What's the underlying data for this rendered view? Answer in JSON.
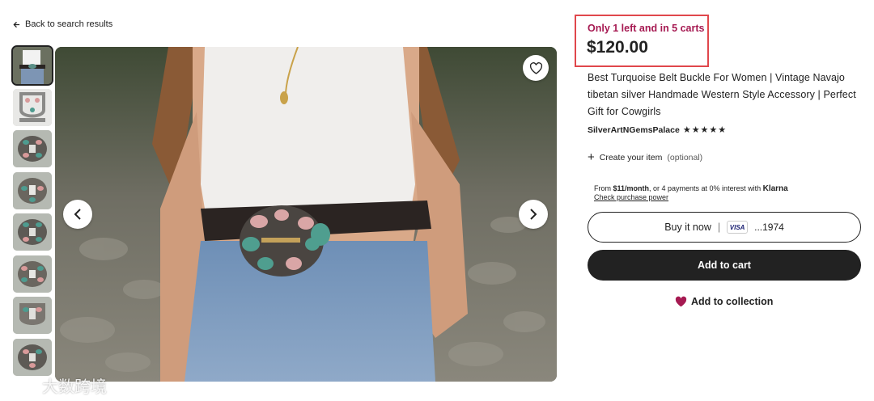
{
  "nav": {
    "back_label": "Back to search results"
  },
  "gallery": {
    "thumbnail_count": 8,
    "active_index": 0
  },
  "product": {
    "stock_message": "Only 1 left and in 5 carts",
    "price": "$120.00",
    "title": "Best Turquoise Belt Buckle For Women | Vintage Navajo tibetan silver Handmade Western Style Accessory | Perfect Gift for Cowgirls",
    "shop_name": "SilverArtNGemsPalace",
    "stars": "★★★★★",
    "rating": 5
  },
  "personalize": {
    "label": "Create your item",
    "optional": "(optional)"
  },
  "klarna": {
    "prefix": "From ",
    "amount": "$11/month",
    "middle": ", or 4 payments at 0% interest with ",
    "brand": "Klarna",
    "link": "Check purchase power"
  },
  "actions": {
    "buy_now_label": "Buy it now",
    "buy_now_separator": "|",
    "card_brand": "VISA",
    "card_last_digits": "...1974",
    "add_to_cart": "Add to cart",
    "add_to_collection": "Add to collection"
  },
  "watermark": {
    "text": "大数跨境"
  },
  "colors": {
    "stock_message": "#a61a52",
    "highlight_box": "#e0474c",
    "primary_button": "#222222",
    "heart": "#a61a52"
  },
  "icons": {
    "back": "arrow-left-icon",
    "favorite": "heart-outline-icon",
    "prev": "chevron-left-icon",
    "next": "chevron-right-icon",
    "plus": "plus-icon",
    "collection": "heart-filled-icon"
  }
}
